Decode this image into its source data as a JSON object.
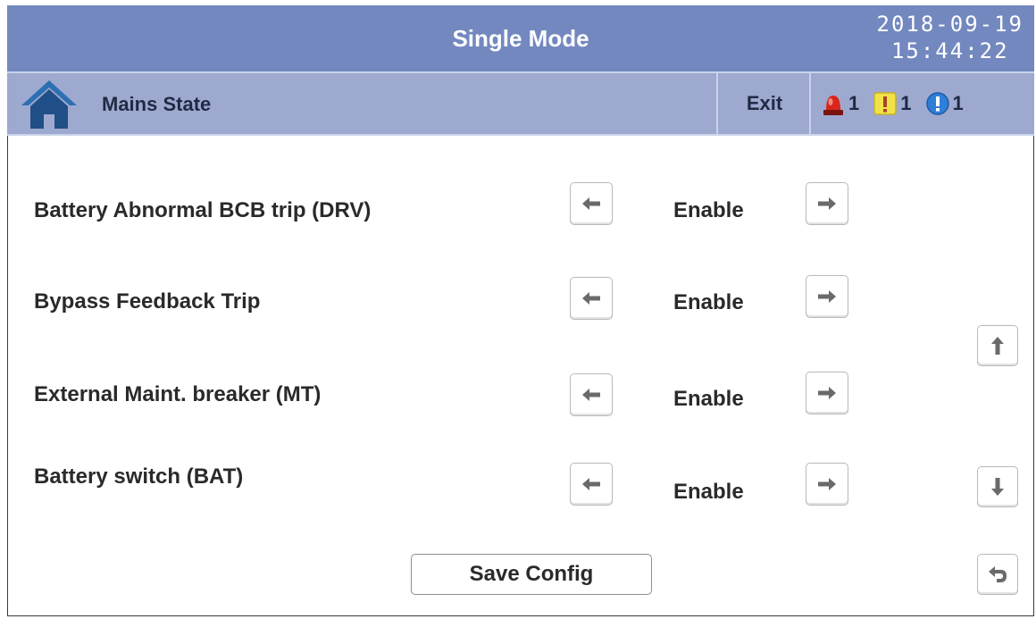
{
  "header": {
    "title": "Single Mode",
    "date": "2018-09-19",
    "time": "15:44:22"
  },
  "subbar": {
    "home_icon": "home-icon",
    "label": "Mains State",
    "exit_label": "Exit",
    "alarms": [
      {
        "icon": "red-beacon-icon",
        "count": "1",
        "color": "#d9261c"
      },
      {
        "icon": "yellow-warning-icon",
        "count": "1",
        "color": "#f2e24a"
      },
      {
        "icon": "blue-info-icon",
        "count": "1",
        "color": "#2f7fd8"
      }
    ]
  },
  "settings": [
    {
      "label": "Battery Abnormal BCB trip (DRV)",
      "value": "Enable"
    },
    {
      "label": "Bypass Feedback Trip",
      "value": "Enable"
    },
    {
      "label": "External Maint. breaker (MT)",
      "value": "Enable"
    },
    {
      "label": "Battery switch (BAT)",
      "value": "Enable"
    }
  ],
  "controls": {
    "save_label": "Save Config",
    "scroll_up_icon": "arrow-up-icon",
    "scroll_down_icon": "arrow-down-icon",
    "back_icon": "return-icon"
  },
  "colors": {
    "title_bar": "#7388bf",
    "sub_bar": "#9ea9d0",
    "text": "#2a2a2a"
  }
}
